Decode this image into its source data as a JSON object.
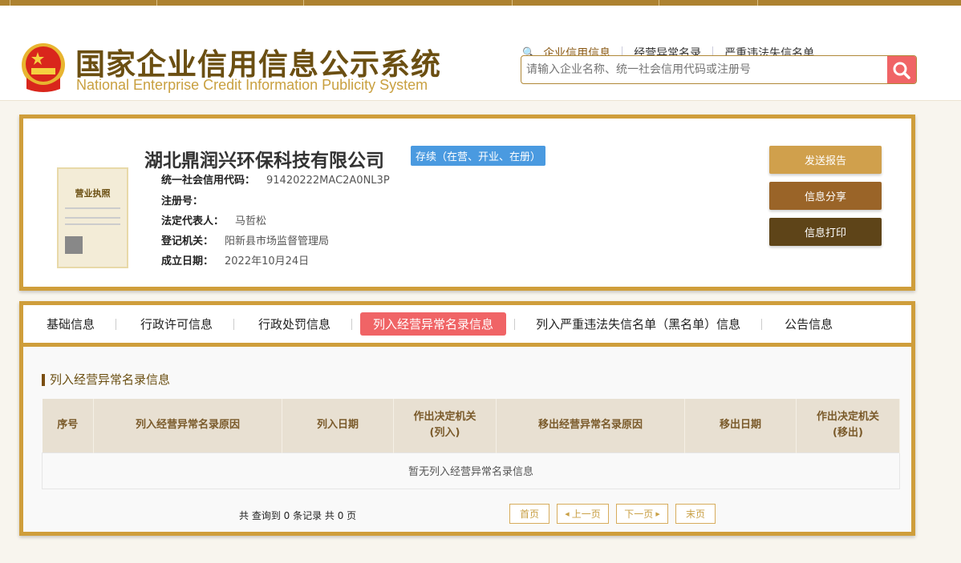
{
  "header": {
    "title_cn": "国家企业信用信息公示系统",
    "title_en": "National Enterprise Credit Information Publicity System",
    "nav": [
      "企业信用信息",
      "经营异常名录",
      "严重违法失信名单"
    ],
    "search_placeholder": "请输入企业名称、统一社会信用代码或注册号"
  },
  "company": {
    "name": "湖北鼎润兴环保科技有限公司",
    "status": "存续（在营、开业、在册）",
    "fields": [
      {
        "label": "统一社会信用代码：",
        "value": "91420222MAC2A0NL3P"
      },
      {
        "label": "注册号：",
        "value": ""
      },
      {
        "label": "法定代表人：",
        "value": "马哲松"
      },
      {
        "label": "登记机关：",
        "value": "阳新县市场监督管理局"
      },
      {
        "label": "成立日期：",
        "value": "2022年10月24日"
      }
    ],
    "license_label": "营业执照",
    "actions": [
      "发送报告",
      "信息分享",
      "信息打印"
    ]
  },
  "tabs": [
    "基础信息",
    "行政许可信息",
    "行政处罚信息",
    "列入经营异常名录信息",
    "列入严重违法失信名单（黑名单）信息",
    "公告信息"
  ],
  "section": {
    "title": "列入经营异常名录信息",
    "columns": [
      "序号",
      "列入经营异常名录原因",
      "列入日期",
      "作出决定机关\n(列入)",
      "移出经营异常名录原因",
      "移出日期",
      "作出决定机关\n(移出)"
    ],
    "empty": "暂无列入经营异常名录信息",
    "count": "共 查询到 0 条记录 共 0 页",
    "pager": [
      "首页",
      "上一页",
      "下一页",
      "末页"
    ]
  },
  "colors": {
    "gold": "#cf9e3b",
    "accent": "#f06466",
    "badge": "#4a9ae0"
  }
}
